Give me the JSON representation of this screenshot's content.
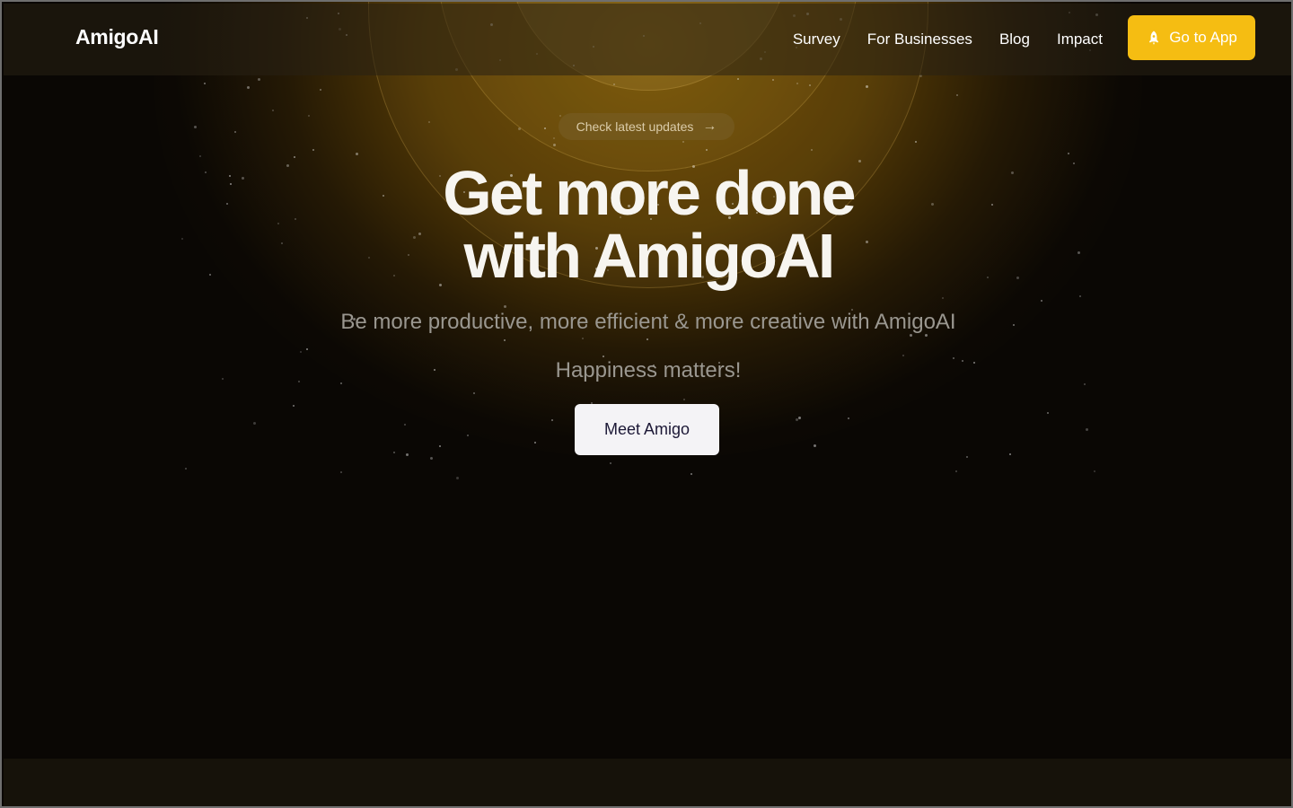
{
  "brand": {
    "name": "AmigoAI"
  },
  "nav": {
    "links": [
      "Survey",
      "For Businesses",
      "Blog",
      "Impact"
    ],
    "cta_label": "Go to App",
    "cta_icon": "rocket-icon"
  },
  "hero": {
    "badge_label": "Check latest updates",
    "badge_icon": "arrow-right-icon",
    "headline_line1": "Get more done",
    "headline_line2": "with AmigoAI",
    "subheadline": "Be more productive, more efficient & more creative with AmigoAI",
    "tagline": "Happiness matters!",
    "button_label": "Meet Amigo"
  },
  "colors": {
    "accent": "#f5bd12",
    "background": "#0a0704",
    "button_text": "#1c1836"
  }
}
